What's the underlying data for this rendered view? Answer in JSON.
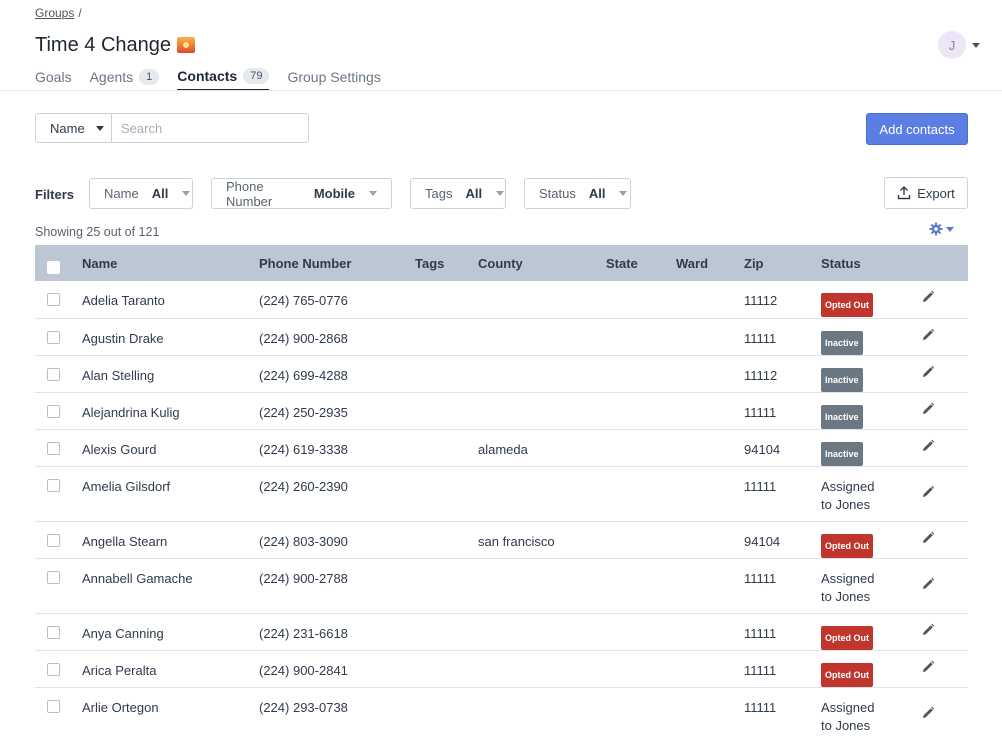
{
  "breadcrumb": {
    "parent": "Groups",
    "separator": "/"
  },
  "page": {
    "title": "Time 4 Change"
  },
  "user": {
    "initial": "J"
  },
  "tabs": [
    {
      "label": "Goals",
      "count": null,
      "active": false
    },
    {
      "label": "Agents",
      "count": "1",
      "active": false
    },
    {
      "label": "Contacts",
      "count": "79",
      "active": true
    },
    {
      "label": "Group Settings",
      "count": null,
      "active": false
    }
  ],
  "search": {
    "field": "Name",
    "placeholder": "Search"
  },
  "toolbar": {
    "add_label": "Add contacts",
    "export_label": "Export"
  },
  "filters": {
    "label": "Filters",
    "items": [
      {
        "name": "Name",
        "value": "All"
      },
      {
        "name": "Phone Number",
        "value": "Mobile"
      },
      {
        "name": "Tags",
        "value": "All"
      },
      {
        "name": "Status",
        "value": "All"
      }
    ]
  },
  "summary": "Showing 25 out of 121",
  "table": {
    "columns": [
      "Name",
      "Phone Number",
      "Tags",
      "County",
      "State",
      "Ward",
      "Zip",
      "Status"
    ],
    "rows": [
      {
        "name": "Adelia Taranto",
        "phone": "(224) 765-0776",
        "tags": "",
        "county": "",
        "state": "",
        "ward": "",
        "zip": "11112",
        "status": "Opted Out",
        "status_type": "opted"
      },
      {
        "name": "Agustin Drake",
        "phone": "(224) 900-2868",
        "tags": "",
        "county": "",
        "state": "",
        "ward": "",
        "zip": "11111",
        "status": "Inactive",
        "status_type": "inactive"
      },
      {
        "name": "Alan Stelling",
        "phone": "(224) 699-4288",
        "tags": "",
        "county": "",
        "state": "",
        "ward": "",
        "zip": "11112",
        "status": "Inactive",
        "status_type": "inactive"
      },
      {
        "name": "Alejandrina Kulig",
        "phone": "(224) 250-2935",
        "tags": "",
        "county": "",
        "state": "",
        "ward": "",
        "zip": "11111",
        "status": "Inactive",
        "status_type": "inactive"
      },
      {
        "name": "Alexis Gourd",
        "phone": "(224) 619-3338",
        "tags": "",
        "county": "alameda",
        "state": "",
        "ward": "",
        "zip": "94104",
        "status": "Inactive",
        "status_type": "inactive"
      },
      {
        "name": "Amelia Gilsdorf",
        "phone": "(224) 260-2390",
        "tags": "",
        "county": "",
        "state": "",
        "ward": "",
        "zip": "11111",
        "status": "Assigned to Jones",
        "status_type": "text"
      },
      {
        "name": "Angella Stearn",
        "phone": "(224) 803-3090",
        "tags": "",
        "county": "san francisco",
        "state": "",
        "ward": "",
        "zip": "94104",
        "status": "Opted Out",
        "status_type": "opted"
      },
      {
        "name": "Annabell Gamache",
        "phone": "(224) 900-2788",
        "tags": "",
        "county": "",
        "state": "",
        "ward": "",
        "zip": "11111",
        "status": "Assigned to Jones",
        "status_type": "text"
      },
      {
        "name": "Anya Canning",
        "phone": "(224) 231-6618",
        "tags": "",
        "county": "",
        "state": "",
        "ward": "",
        "zip": "11111",
        "status": "Opted Out",
        "status_type": "opted"
      },
      {
        "name": "Arica Peralta",
        "phone": "(224) 900-2841",
        "tags": "",
        "county": "",
        "state": "",
        "ward": "",
        "zip": "11111",
        "status": "Opted Out",
        "status_type": "opted"
      },
      {
        "name": "Arlie Ortegon",
        "phone": "(224) 293-0738",
        "tags": "",
        "county": "",
        "state": "",
        "ward": "",
        "zip": "11111",
        "status": "Assigned to Jones",
        "status_type": "text"
      }
    ]
  },
  "icons": {
    "export": "upload-icon",
    "settings": "gear-icon",
    "edit": "pencil-icon",
    "title": "sunset-icon"
  },
  "colors": {
    "primary": "#5b7ee5",
    "header_bg": "#bdc7d4",
    "opted_out": "#c0362c",
    "inactive": "#6c7784"
  }
}
